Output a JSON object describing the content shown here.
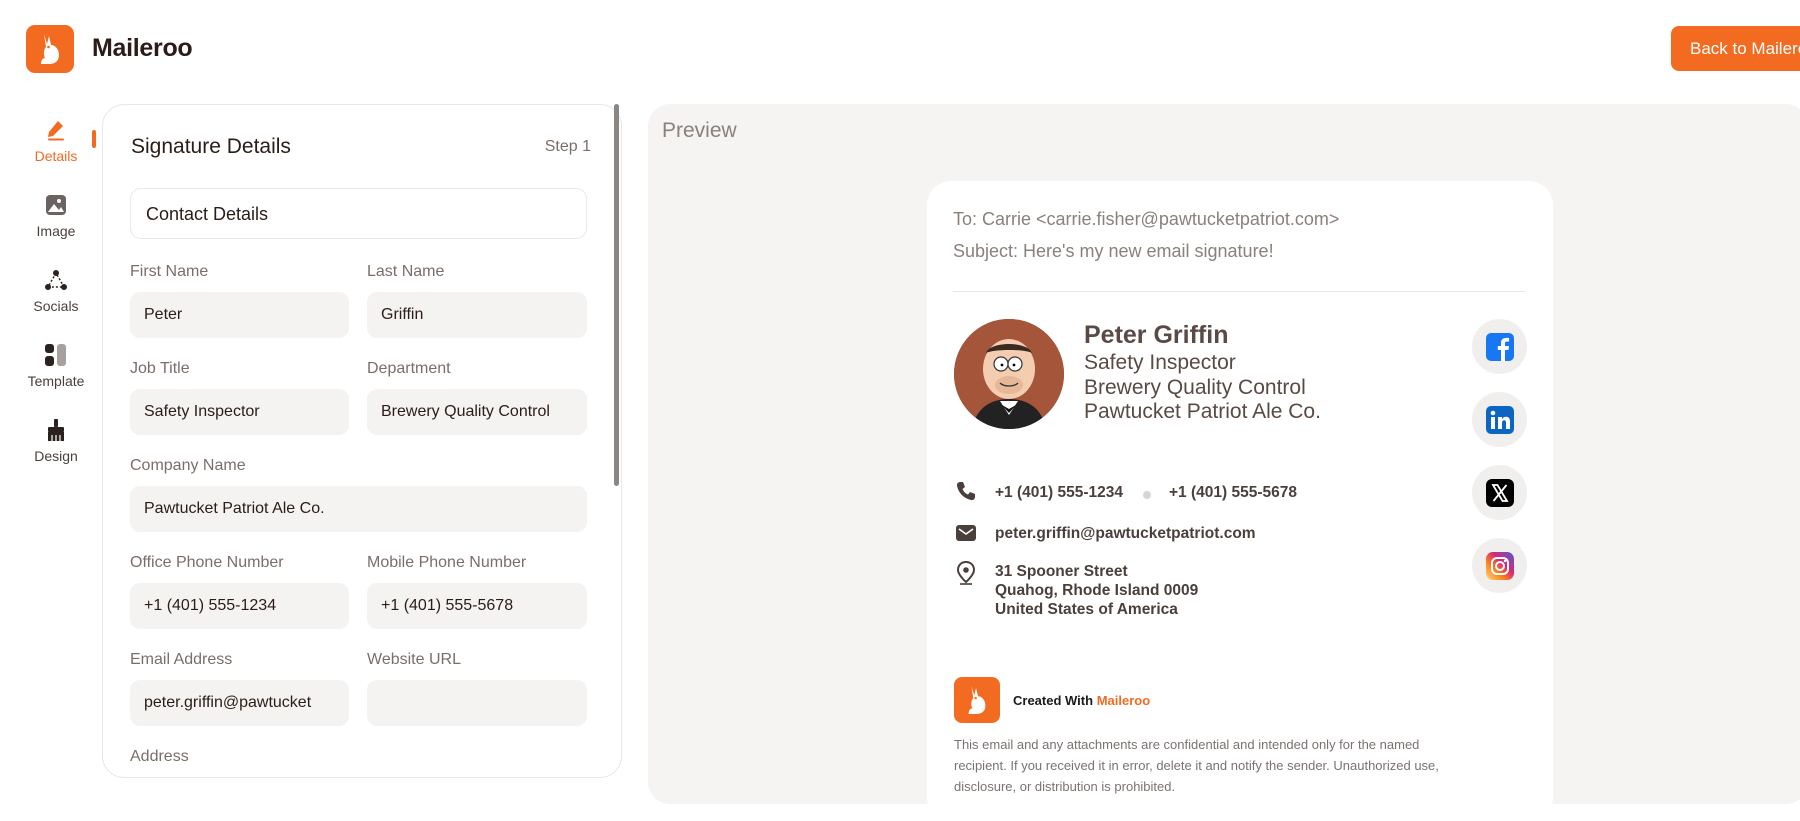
{
  "header": {
    "brand": "Maileroo",
    "back_button": "Back to Maileroo",
    "brand_color": "#f26b21"
  },
  "nav": {
    "items": [
      {
        "label": "Details",
        "icon": "pencil-icon",
        "active": true
      },
      {
        "label": "Image",
        "icon": "image-icon",
        "active": false
      },
      {
        "label": "Socials",
        "icon": "share-nodes-icon",
        "active": false
      },
      {
        "label": "Template",
        "icon": "template-icon",
        "active": false
      },
      {
        "label": "Design",
        "icon": "brush-icon",
        "active": false
      }
    ]
  },
  "form": {
    "title": "Signature Details",
    "step": "Step 1",
    "section": "Contact Details",
    "fields": {
      "first_name": {
        "label": "First Name",
        "value": "Peter"
      },
      "last_name": {
        "label": "Last Name",
        "value": "Griffin"
      },
      "job_title": {
        "label": "Job Title",
        "value": "Safety Inspector"
      },
      "department": {
        "label": "Department",
        "value": "Brewery Quality Control"
      },
      "company": {
        "label": "Company Name",
        "value": "Pawtucket Patriot Ale Co."
      },
      "office_phone": {
        "label": "Office Phone Number",
        "value": "+1 (401) 555-1234"
      },
      "mobile_phone": {
        "label": "Mobile Phone Number",
        "value": "+1 (401) 555-5678"
      },
      "email": {
        "label": "Email Address",
        "value": "peter.griffin@pawtucket"
      },
      "website": {
        "label": "Website URL",
        "value": ""
      },
      "address": {
        "label": "Address"
      }
    }
  },
  "preview": {
    "title": "Preview",
    "to": "To: Carrie <carrie.fisher@pawtucketpatriot.com>",
    "subject": "Subject: Here's my new email signature!",
    "signature": {
      "name": "Peter Griffin",
      "job_title": "Safety Inspector",
      "department": "Brewery Quality Control",
      "company": "Pawtucket Patriot Ale Co.",
      "office_phone": "+1 (401) 555-1234",
      "mobile_phone": "+1 (401) 555-5678",
      "email": "peter.griffin@pawtucketpatriot.com",
      "address_line1": "31 Spooner Street",
      "address_line2": "Quahog, Rhode Island 0009",
      "address_line3": "United States of America"
    },
    "socials": [
      "facebook-icon",
      "linkedin-icon",
      "x-twitter-icon",
      "instagram-icon"
    ],
    "created_with": "Created With",
    "created_brand": "Maileroo",
    "disclaimer": "This email and any attachments are confidential and intended only for the named recipient. If you received it in error, delete it and notify the sender. Unauthorized use, disclosure, or distribution is prohibited."
  }
}
